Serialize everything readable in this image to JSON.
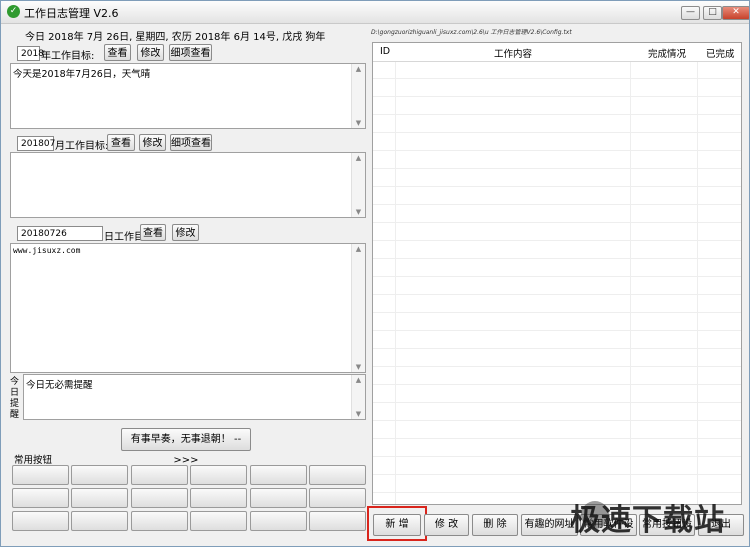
{
  "window": {
    "title": "工作日志管理 V2.6",
    "minimize": "—",
    "maximize": "□",
    "close": "✕"
  },
  "date_line": "今日 2018年 7月 26日, 星期四, 农历 2018年 6月 14号, 戊戌 狗年",
  "path_text": "D:\\gongzuorizhiguanli_jisuxz.com\\2.6\\u 工作日志管理V2.6\\Config.txt",
  "year_goal": {
    "value": "2018",
    "label": "年工作目标:",
    "view": "查看",
    "edit": "修改",
    "detail": "细项查看",
    "content": "今天是2018年7月26日，天气晴"
  },
  "month_goal": {
    "value": "201807",
    "label": "月工作目标:",
    "view": "查看",
    "edit": "修改",
    "detail": "细项查看",
    "content": ""
  },
  "day_goal": {
    "value": "20180726",
    "label": "日工作目标:",
    "view": "查看",
    "edit": "修改",
    "content": "www.jisuxz.com"
  },
  "reminder": {
    "label": "今日提醒",
    "content": "今日无必需提醒"
  },
  "motto_button": "有事早奏，无事退朝！ -->>>",
  "common_buttons_label": "常用按钮",
  "table": {
    "columns": [
      "ID",
      "工作内容",
      "完成情况",
      "已完成"
    ],
    "rows": []
  },
  "bottom_buttons": {
    "add": "新  增",
    "edit": "修  改",
    "delete": "删  除",
    "fun_sites": "有趣的网址",
    "common_software": "常用软件设置",
    "common_buttons_set": "常用按钮设置",
    "exit": "退出"
  },
  "watermark": "极速下载站"
}
